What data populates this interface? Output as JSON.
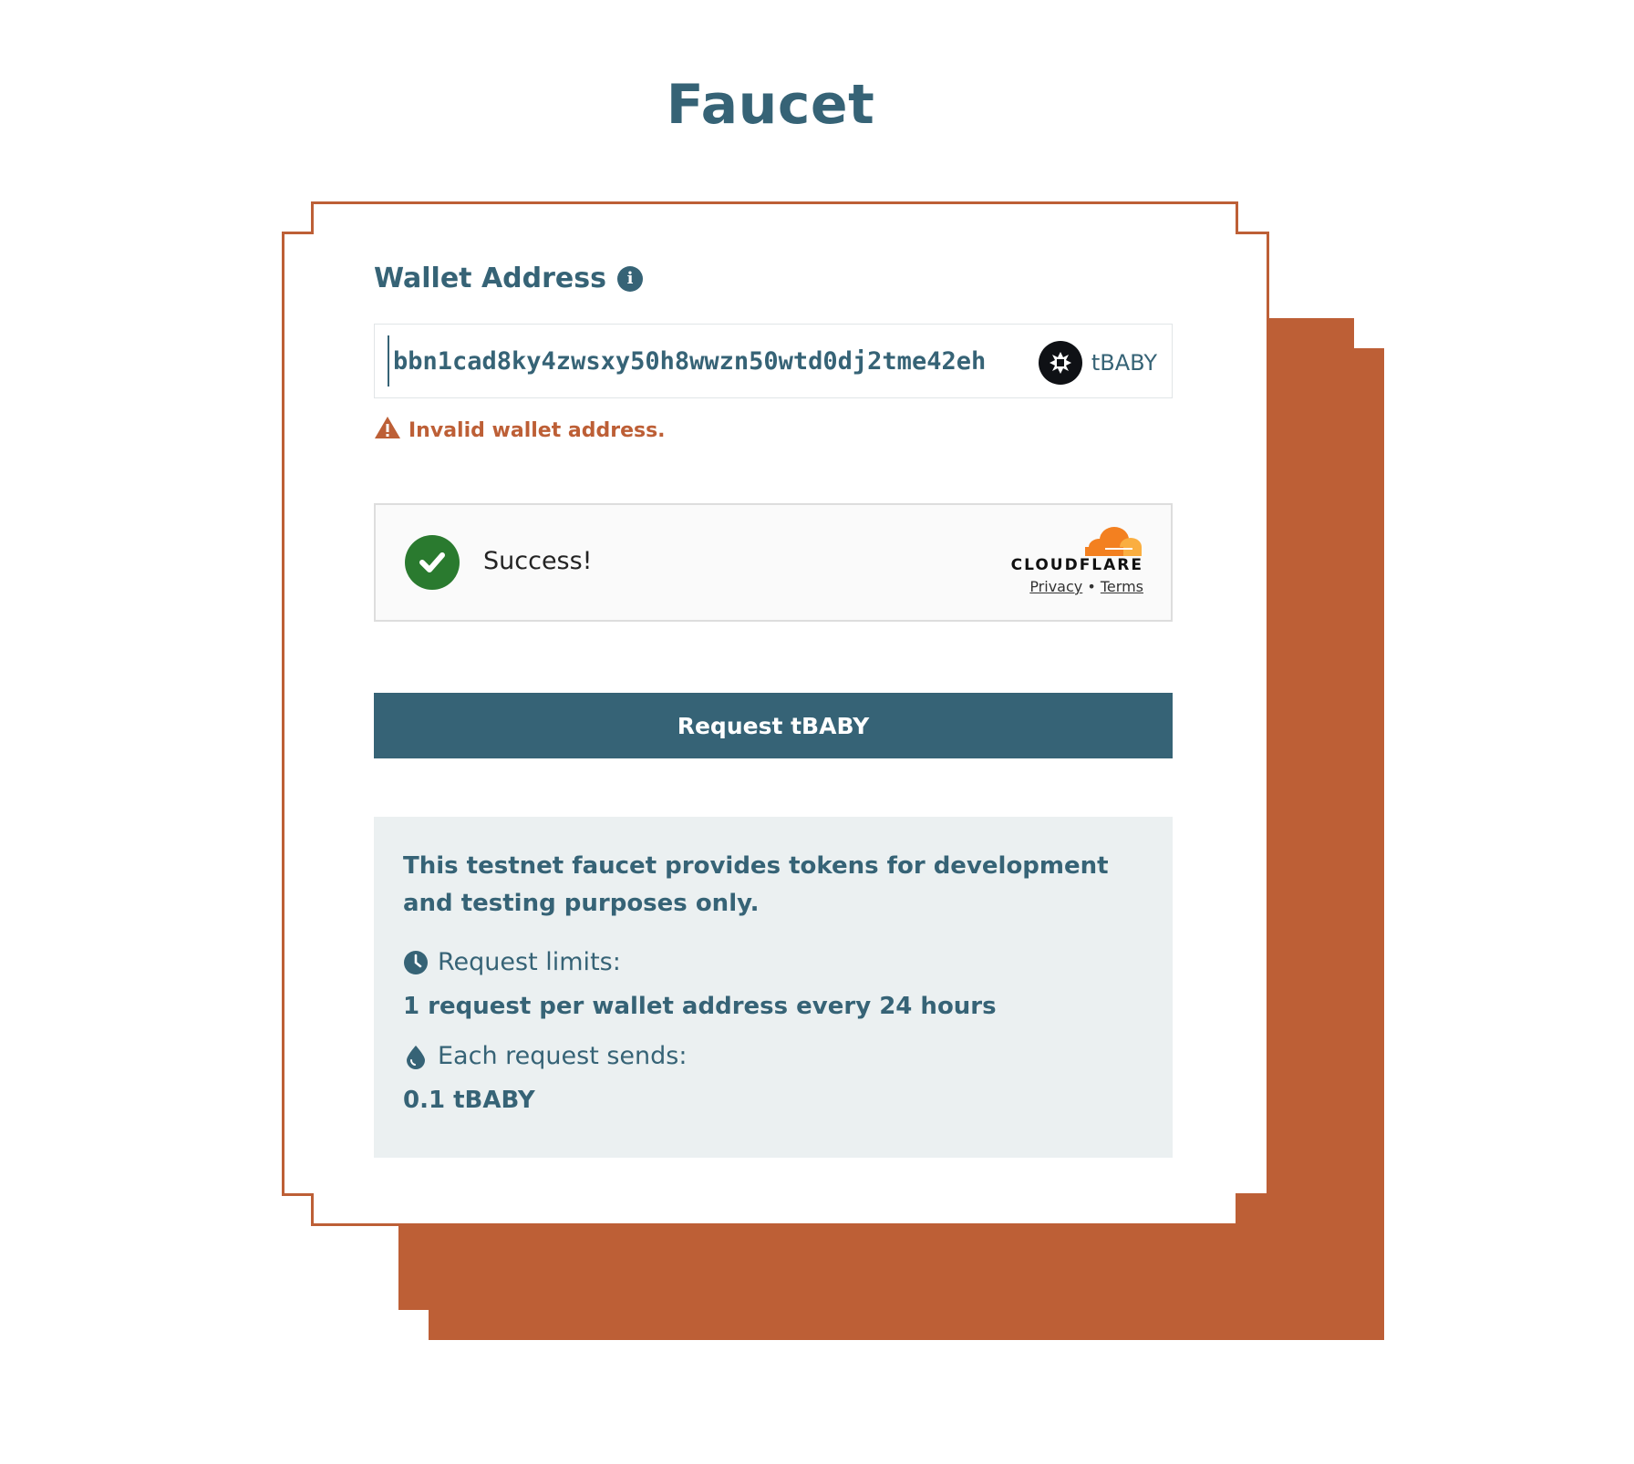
{
  "page": {
    "title": "Faucet"
  },
  "wallet": {
    "label": "Wallet Address",
    "value": "bbn1cad8ky4zwsxy50h8wwzn50wtd0dj2tme42eh",
    "token": "tBABY",
    "error": "Invalid wallet address."
  },
  "captcha": {
    "status": "Success!",
    "brand": "CLOUDFLARE",
    "privacy": "Privacy",
    "separator": "•",
    "terms": "Terms"
  },
  "request_button": {
    "label": "Request tBABY"
  },
  "info": {
    "description": "This testnet faucet provides tokens for development and testing purposes only.",
    "limits_label": "Request limits:",
    "limits_value": "1 request per wallet address every 24 hours",
    "sends_label": "Each request sends:",
    "sends_value": "0.1 tBABY"
  },
  "colors": {
    "primary": "#366376",
    "accent": "#bd5f36",
    "success": "#2a7a2f",
    "panel": "#ebf0f1",
    "cloudflare_orange": "#f38020"
  },
  "icons": {
    "label": "info-icon",
    "token": "baby-token-logo",
    "error": "warning-icon",
    "captcha": "check-circle-icon",
    "limits": "clock-icon",
    "sends": "droplet-icon"
  }
}
